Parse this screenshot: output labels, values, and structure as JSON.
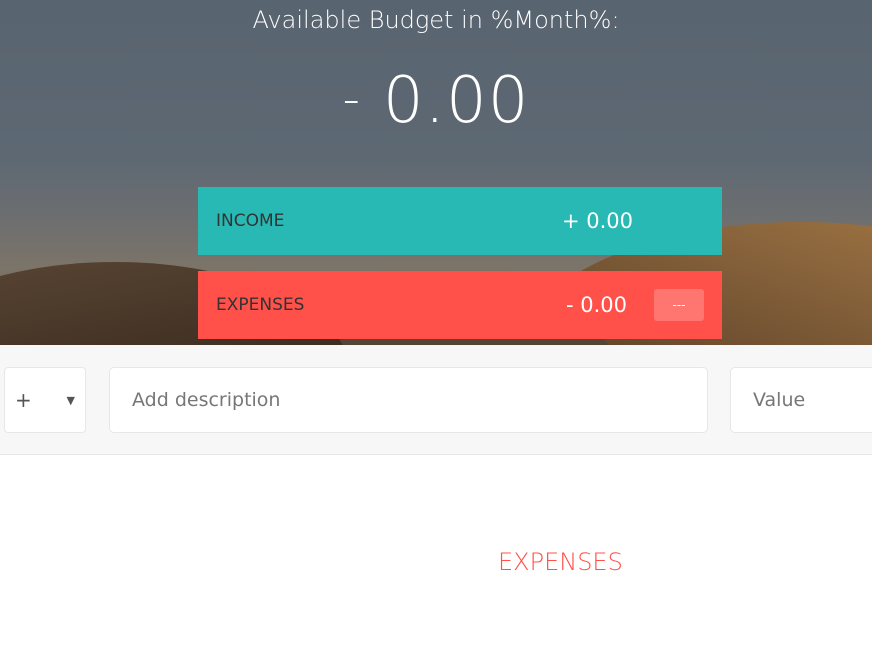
{
  "header": {
    "title": "Available Budget in %Month%:",
    "budget_sign": "-",
    "budget_value": "0.00"
  },
  "income": {
    "label": "INCOME",
    "value": "+ 0.00"
  },
  "expenses": {
    "label": "EXPENSES",
    "value": "- 0.00",
    "percentage": "---"
  },
  "add_form": {
    "type_options": [
      "+"
    ],
    "type_selected": "+",
    "description_placeholder": "Add description",
    "value_placeholder": "Value"
  },
  "lists": {
    "expenses_title": "EXPENSES"
  },
  "colors": {
    "income": "#28b9b5",
    "expenses": "#ff5049"
  },
  "icons": {
    "dropdown": "chevron-down-icon"
  }
}
